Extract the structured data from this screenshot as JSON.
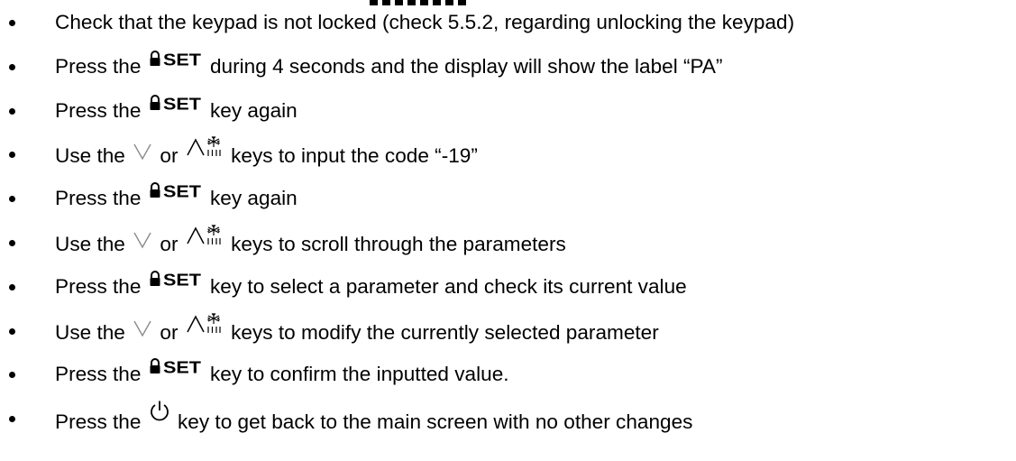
{
  "steps": [
    {
      "parts": [
        "Check that the keypad is not locked (check 5.5.2, regarding unlocking the keypad)"
      ]
    },
    {
      "parts": [
        "Press the ",
        "{set}",
        " during 4 seconds and the display will show the label “PA”"
      ]
    },
    {
      "parts": [
        "Press the ",
        "{set}",
        " key again"
      ]
    },
    {
      "parts": [
        "Use the ",
        "{down}",
        " or ",
        "{up}",
        " keys to input the code “-19”"
      ]
    },
    {
      "parts": [
        "Press the ",
        "{set}",
        " key again"
      ]
    },
    {
      "parts": [
        "Use the ",
        "{down}",
        " or ",
        "{up}",
        " keys to scroll through the parameters"
      ]
    },
    {
      "parts": [
        "Press the ",
        "{set}",
        " key to select a parameter and check its current value"
      ]
    },
    {
      "parts": [
        "Use the ",
        "{down}",
        " or ",
        "{up}",
        " keys to modify the currently selected parameter"
      ]
    },
    {
      "parts": [
        "Press the ",
        "{set}",
        " key to confirm the inputted value."
      ]
    },
    {
      "parts": [
        "Press the ",
        "{power}",
        " key to get back to the main screen with no other changes"
      ]
    }
  ],
  "icons": {
    "set": "lock-set-key-icon",
    "down": "chevron-down-key-icon",
    "up": "chevron-up-defrost-key-icon",
    "power": "power-key-icon"
  },
  "key_label_set": "SET"
}
